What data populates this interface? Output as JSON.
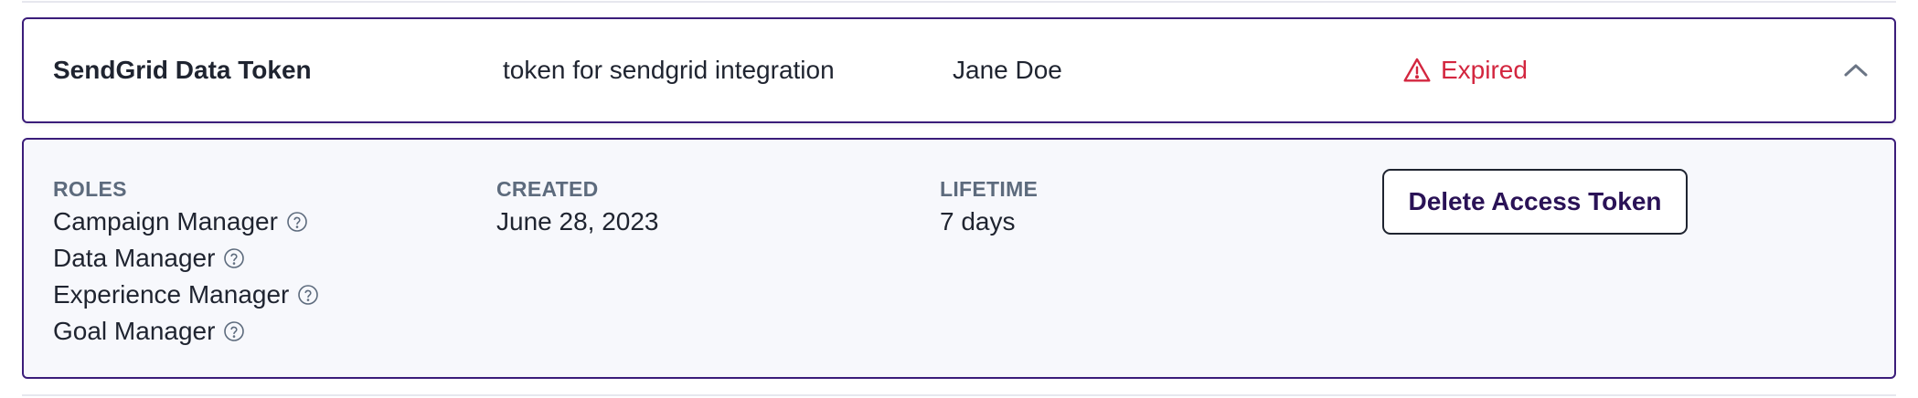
{
  "token": {
    "name": "SendGrid Data Token",
    "description": "token for sendgrid integration",
    "owner": "Jane Doe",
    "status": "Expired"
  },
  "details": {
    "roles_label": "ROLES",
    "roles": [
      {
        "name": "Campaign Manager"
      },
      {
        "name": "Data Manager"
      },
      {
        "name": "Experience Manager"
      },
      {
        "name": "Goal Manager"
      }
    ],
    "created_label": "CREATED",
    "created_value": "June 28, 2023",
    "lifetime_label": "LIFETIME",
    "lifetime_value": "7 days",
    "delete_label": "Delete Access Token"
  },
  "icons": {
    "status": "warning-triangle-icon",
    "collapse": "chevron-up-icon",
    "role_help": "question-circle-icon"
  },
  "colors": {
    "border_accent": "#3b1d7a",
    "status_error": "#d3263f",
    "label_muted": "#5d6b7d",
    "details_bg": "#f7f8fc",
    "button_text": "#2a1256"
  }
}
